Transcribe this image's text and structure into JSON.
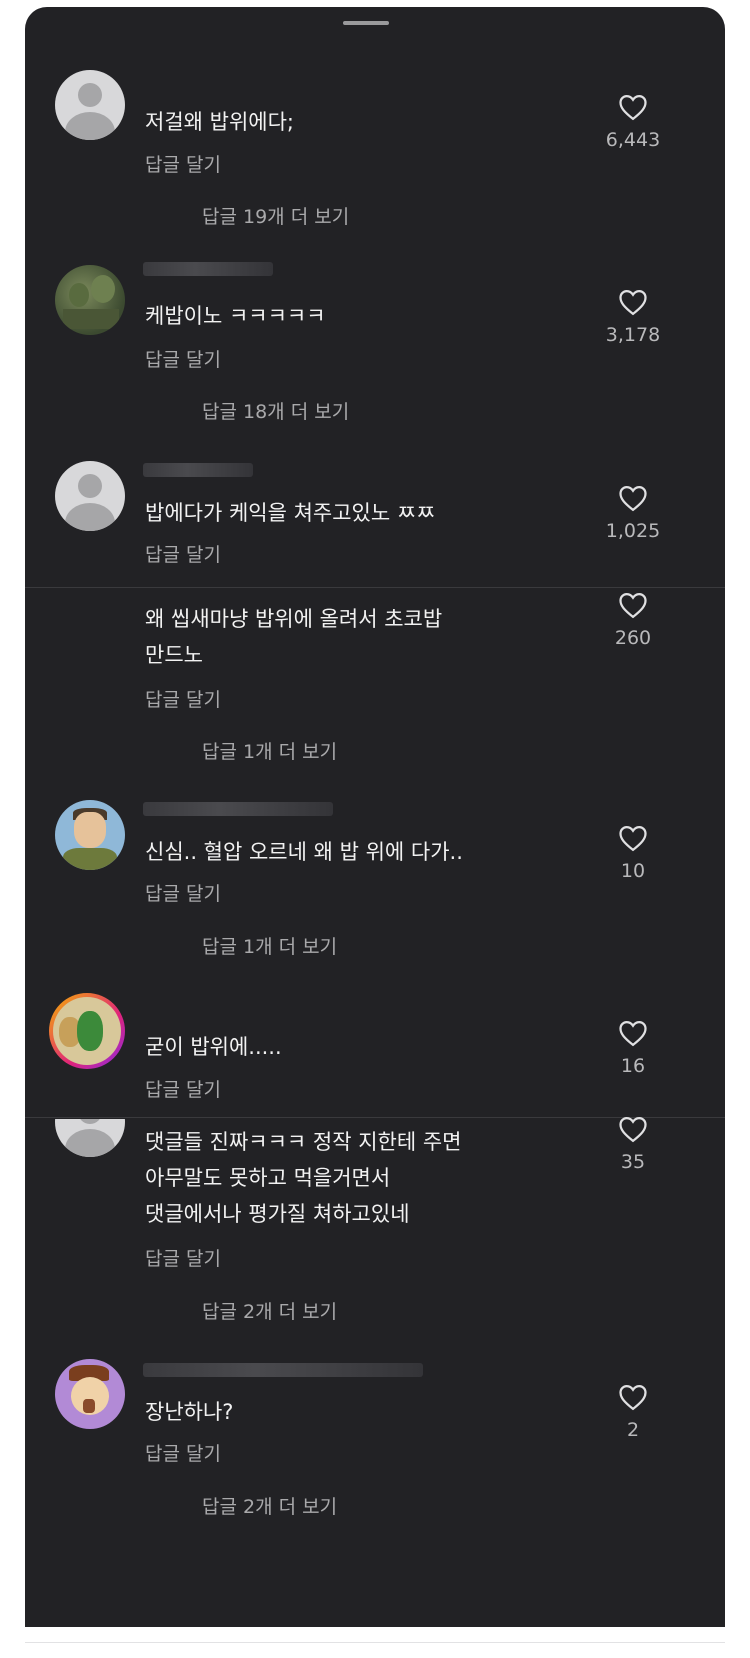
{
  "comments": [
    {
      "text": "저걸왜 밥위에다;",
      "likes": "6,443",
      "reply_label": "답글 달기",
      "more_replies": "답글 19개 더 보기",
      "avatar": "default-avatar"
    },
    {
      "text": "케밥이노 ㅋㅋㅋㅋㅋ",
      "likes": "3,178",
      "reply_label": "답글 달기",
      "more_replies": "답글 18개 더 보기",
      "avatar": "forest-avatar"
    },
    {
      "text": "밥에다가 케익을 쳐주고있노 ㅉㅉ",
      "likes": "1,025",
      "reply_label": "답글 달기",
      "avatar": "default-avatar"
    },
    {
      "text": "왜 씹새마냥 밥위에 올려서 초코밥\n만드노",
      "likes": "260",
      "reply_label": "답글 달기",
      "more_replies": "답글 1개 더 보기"
    },
    {
      "text": "신심.. 혈압 오르네 왜 밥 위에 다가..",
      "likes": "10",
      "reply_label": "답글 달기",
      "more_replies": "답글 1개 더 보기",
      "avatar": "cartoon-avatar"
    },
    {
      "text": "굳이 밥위에.....",
      "likes": "16",
      "reply_label": "답글 달기",
      "avatar": "story-ring-avatar"
    },
    {
      "text": "댓글들 진짜ㅋㅋㅋ 정작 지한테 주면\n아무말도 못하고 먹을거면서\n댓글에서나 평가질 쳐하고있네",
      "likes": "35",
      "reply_label": "답글 달기",
      "more_replies": "답글 2개 더 보기",
      "avatar": "default-avatar"
    },
    {
      "text": "장난하나?",
      "likes": "2",
      "reply_label": "답글 달기",
      "more_replies": "답글 2개 더 보기",
      "avatar": "purple-character-avatar"
    }
  ],
  "colors": {
    "sheet_bg": "#222225",
    "text": "#f2f2f2",
    "muted": "#a9a9ab"
  }
}
